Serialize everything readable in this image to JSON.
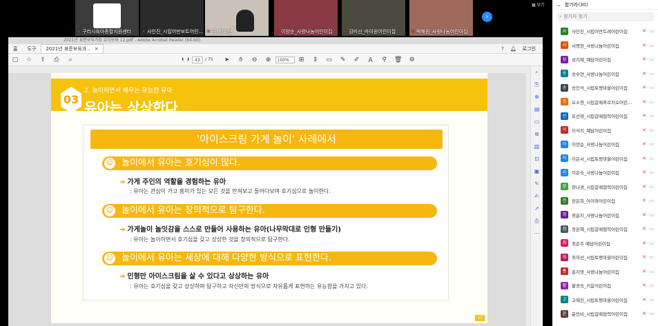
{
  "meeting": {
    "view_label": "보기",
    "next_icon": "chevron-right-icon",
    "video_tiles": [
      {
        "name": "구리시육아종합지원센터",
        "muted": true
      },
      {
        "name": "사인진_시립어반보트어린...",
        "muted": true
      },
      {
        "name": "권_청소년",
        "muted": true
      },
      {
        "name": "이양순_사랑나눔어린이집",
        "muted": true
      },
      {
        "name": "김미선_마이원어린이집",
        "muted": true
      },
      {
        "name": "박해원_사랑나눔어린이집",
        "muted": true
      }
    ]
  },
  "viewer": {
    "title_text": "2021년 표준보육과정 유아보육 12.pdf - Adobe Acrobat Reader (64-bit)",
    "menu": [
      "홈",
      "도구"
    ],
    "tab_label": "2021년 표준보육과...",
    "right_menu": [
      "?",
      "로그인"
    ],
    "page_current": "43",
    "page_total": "/ 75",
    "zoom": "100%"
  },
  "slide": {
    "number": "03",
    "subtitle": "2. 놀이하면서 배우는 유능한 유아",
    "title": "유아는 상상한다",
    "panel_title": "'아이스크림 가게 놀이' 사례에서",
    "sections": [
      {
        "heading": "놀이에서 유아는 호기심이 많다.",
        "item": "가게 주인의 역할을 경험하는 유아",
        "desc": ": 유아는 관심이 가고 흥미가 있는 모든 것을 만져보고 들어다보며 호기심으로 놀이한다."
      },
      {
        "heading": "놀이에서 유아는 창의적으로 탐구한다.",
        "item": "가게놀이 놀잇감을 스스로 만들어 사용하는 유아(나무막대로 인형 만들기)",
        "desc": ": 유아는 놀이하면서 호기심을 갖고 상상한 것을 창의적으로 탐구한다."
      },
      {
        "heading": "놀이에서 유아는 세상에 대해 다양한 방식으로 표현한다.",
        "item": "인형만 아이스크림을 살 수 있다고 상상하는 유아",
        "desc": ": 유아는 호기심을 갖고 상상하며 탐구하고 자신만의 방식으로 자유롭게 표현하는 유능함을 가지고 있다."
      }
    ],
    "page_label": "43"
  },
  "participants": {
    "title": "참가자(30)",
    "search_placeholder": "참가자 찾기",
    "list": [
      {
        "initial": "사",
        "name": "사인진_시립어반트레어린이집",
        "color": "#2e7d32"
      },
      {
        "initial": "서",
        "name": "서명현_사랑나눔어린이집",
        "color": "#e65100"
      },
      {
        "initial": "성",
        "name": "성지혜_예담어린이집",
        "color": "#7b1fa2"
      },
      {
        "initial": "송",
        "name": "송수연_사랑나눔어린이집",
        "color": "#00838f"
      },
      {
        "initial": "송",
        "name": "송인석_시립토평마을어린이집",
        "color": "#37474f"
      },
      {
        "initial": "오",
        "name": "오소영_시립갈매푸르지오어린...",
        "color": "#ef6c00"
      },
      {
        "initial": "선영",
        "name": "유선영_시립갈매협력어린이집",
        "color": "#1565c0"
      },
      {
        "initial": "이",
        "name": "이석지_예담어린이집",
        "color": "#c62828"
      },
      {
        "initial": "이",
        "name": "이양순_사랑나눔어린이집",
        "color": "#1e88e5"
      },
      {
        "initial": "이",
        "name": "이은서_시립토평마을어린이집",
        "color": "#1e88e5"
      },
      {
        "initial": "이",
        "name": "이은숙_사랑나눔어린이집",
        "color": "#1e88e5"
      },
      {
        "initial": "장",
        "name": "장나경_시립갈매협력어린이집",
        "color": "#43a047"
      },
      {
        "initial": "전",
        "name": "전은희_아이와어린이집",
        "color": "#2e7d32"
      },
      {
        "initial": "정",
        "name": "정윤지_사랑나눔어린이집",
        "color": "#6a1b9a"
      },
      {
        "initial": "정",
        "name": "정은혜_시립갈매협력어린이집",
        "color": "#455a64"
      },
      {
        "initial": "최",
        "name": "최은주 예담어린이집",
        "color": "#d81b60"
      },
      {
        "initial": "최",
        "name": "최하선_시립토평마을어린이집",
        "color": "#c2185b"
      },
      {
        "initial": "홍",
        "name": "홍지영_사랑나눔어린이집",
        "color": "#c62828"
      },
      {
        "initial": "황",
        "name": "황경숙_키움어린이집",
        "color": "#8e24aa"
      },
      {
        "initial": "고",
        "name": "고예진_시립토평마을어린이집",
        "color": "#00897b"
      },
      {
        "initial": "윤",
        "name": "윤민비_시립갈매협력어린이집",
        "color": "#5d4037"
      }
    ]
  }
}
